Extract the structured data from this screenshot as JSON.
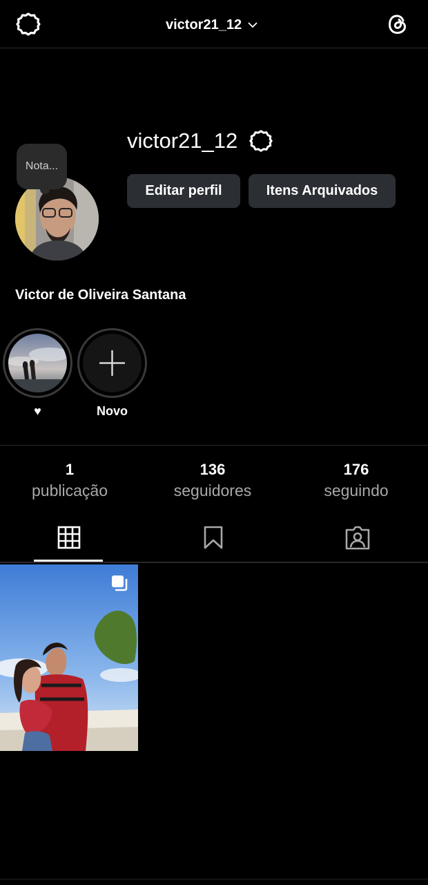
{
  "topbar": {
    "username": "victor21_12",
    "settings_icon": "gear-icon",
    "dropdown_icon": "chevron-down-icon",
    "threads_icon": "threads-icon"
  },
  "note": {
    "text": "Nota..."
  },
  "profile": {
    "username": "victor21_12",
    "edit_button": "Editar perfil",
    "archive_button": "Itens Arquivados",
    "full_name": "Victor de Oliveira Santana"
  },
  "highlights": [
    {
      "label": "♥",
      "kind": "photo"
    },
    {
      "label": "Novo",
      "kind": "add"
    }
  ],
  "stats": [
    {
      "value": "1",
      "label": "publicação"
    },
    {
      "value": "136",
      "label": "seguidores"
    },
    {
      "value": "176",
      "label": "seguindo"
    }
  ],
  "tabs": [
    {
      "name": "posts",
      "icon": "grid-icon",
      "active": true
    },
    {
      "name": "saved",
      "icon": "bookmark-icon",
      "active": false
    },
    {
      "name": "tagged",
      "icon": "tagged-user-icon",
      "active": false
    }
  ],
  "posts": [
    {
      "type": "carousel",
      "icon": "carousel-icon"
    }
  ]
}
